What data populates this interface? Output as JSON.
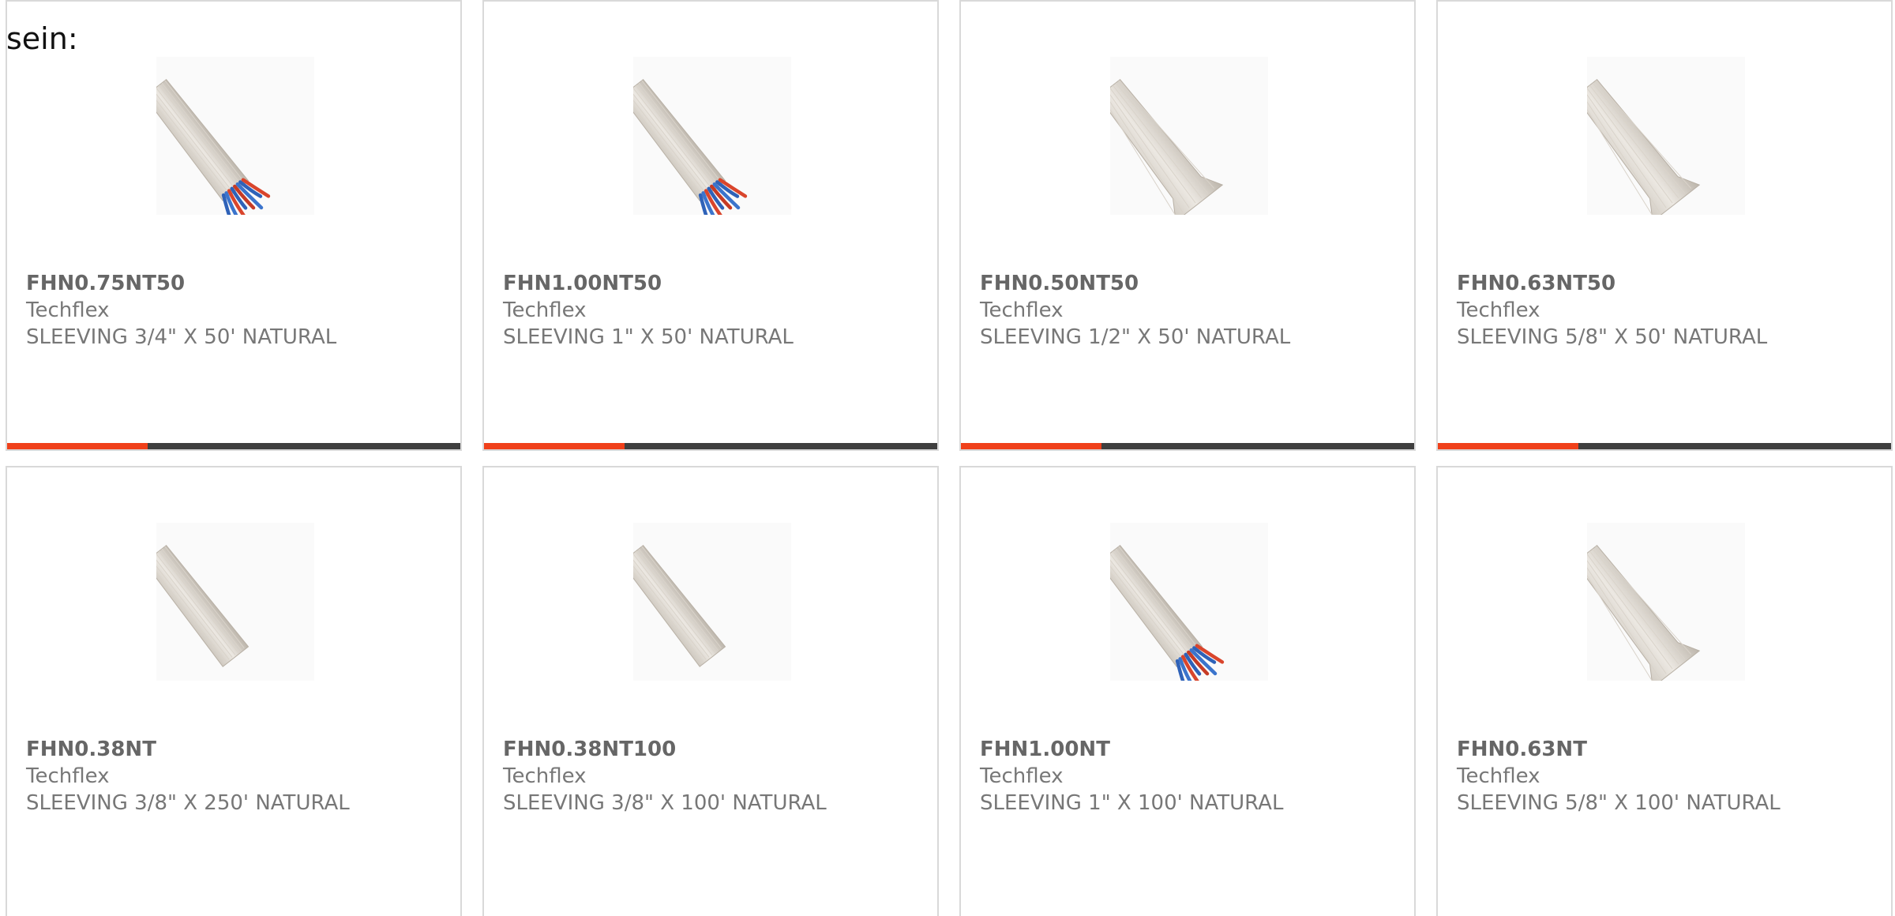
{
  "page": {
    "label": "sein:"
  },
  "products": [
    {
      "part_number": "FHN0.75NT50",
      "manufacturer": "Techflex",
      "description": "SLEEVING 3/4\" X 50' NATURAL",
      "image": "sleeving-with-wires",
      "progress": 0.31
    },
    {
      "part_number": "FHN1.00NT50",
      "manufacturer": "Techflex",
      "description": "SLEEVING 1\" X 50' NATURAL",
      "image": "sleeving-with-wires",
      "progress": 0.31
    },
    {
      "part_number": "FHN0.50NT50",
      "manufacturer": "Techflex",
      "description": "SLEEVING 1/2\" X 50' NATURAL",
      "image": "sleeving-flared",
      "progress": 0.31
    },
    {
      "part_number": "FHN0.63NT50",
      "manufacturer": "Techflex",
      "description": "SLEEVING 5/8\" X 50' NATURAL",
      "image": "sleeving-flared",
      "progress": 0.31
    },
    {
      "part_number": "FHN0.38NT",
      "manufacturer": "Techflex",
      "description": "SLEEVING 3/8\" X 250' NATURAL",
      "image": "sleeving-plain"
    },
    {
      "part_number": "FHN0.38NT100",
      "manufacturer": "Techflex",
      "description": "SLEEVING 3/8\" X 100' NATURAL",
      "image": "sleeving-plain"
    },
    {
      "part_number": "FHN1.00NT",
      "manufacturer": "Techflex",
      "description": "SLEEVING 1\" X 100' NATURAL",
      "image": "sleeving-with-wires"
    },
    {
      "part_number": "FHN0.63NT",
      "manufacturer": "Techflex",
      "description": "SLEEVING 5/8\" X 100' NATURAL",
      "image": "sleeving-flared"
    }
  ],
  "colors": {
    "accent": "#f0401a",
    "track": "#3f3f3f",
    "border": "#d9d9d9",
    "part_number_text": "#666666",
    "body_text": "#777777"
  }
}
